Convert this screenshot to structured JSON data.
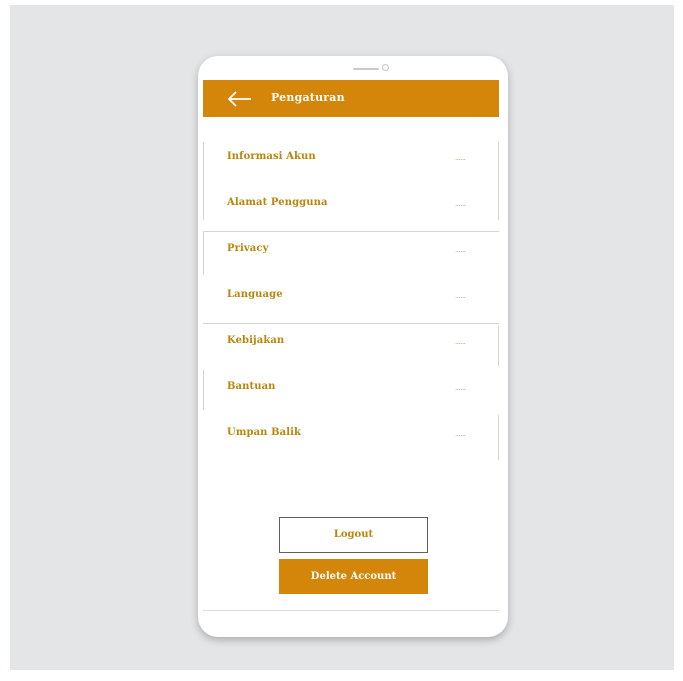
{
  "colors": {
    "accent": "#d4860a",
    "text_gold": "#b8860b",
    "muted_value": "#b7a27a",
    "background": "#e4e5e7"
  },
  "header": {
    "back_icon": "arrow-left-icon",
    "title": "Pengaturan"
  },
  "settings": [
    {
      "label": "Informasi Akun",
      "value": "......"
    },
    {
      "label": "Alamat Pengguna",
      "value": "......"
    },
    {
      "label": "Privacy",
      "value": "......"
    },
    {
      "label": "Language",
      "value": "......"
    },
    {
      "label": "Kebijakan",
      "value": "......"
    },
    {
      "label": "Bantuan",
      "value": "......"
    },
    {
      "label": "Umpan Balik",
      "value": "......"
    }
  ],
  "actions": {
    "logout_label": "Logout",
    "delete_label": "Delete Account"
  }
}
